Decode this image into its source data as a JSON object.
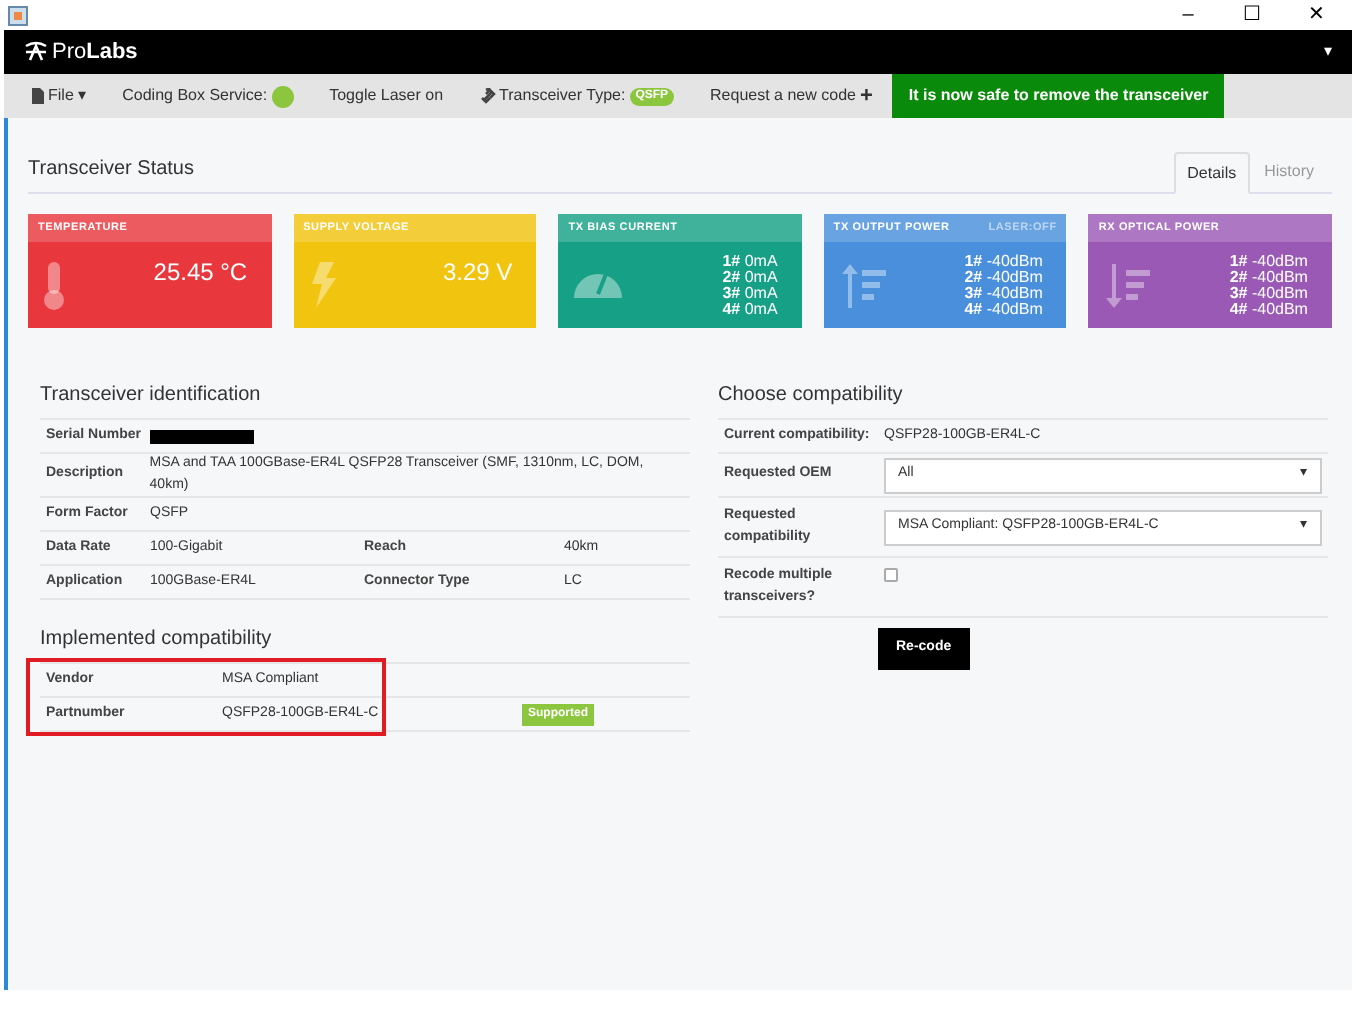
{
  "window": {
    "controls": [
      "–",
      "☐",
      "✕"
    ]
  },
  "app_bar": {
    "logo": "Pro**Labs**",
    "menu_caret": "▾"
  },
  "toolbar": {
    "file": "File",
    "file_caret": "▾",
    "coding_box_label": "Coding Box Service:",
    "coding_box_on": true,
    "toggle_laser": "Toggle Laser on",
    "transceiver_type_label": "Transceiver Type:",
    "transceiver_type": "QSFP",
    "request_code": "Request a new code",
    "request_plus": "+",
    "safe_notice": "It is now safe to remove the transceiver"
  },
  "status": {
    "title": "Transceiver Status",
    "tabs": [
      {
        "label": "Details",
        "selected": true
      },
      {
        "label": "History",
        "selected": false
      }
    ],
    "cards": [
      {
        "kind": "single",
        "title": "TEMPERATURE",
        "color": "#e8383d",
        "value": "25.45 °C"
      },
      {
        "kind": "single",
        "title": "SUPPLY VOLTAGE",
        "color": "#f1c40f",
        "value": "3.29 V"
      },
      {
        "kind": "lanes",
        "title": "TX BIAS CURRENT",
        "color": "#16a085",
        "lanes": [
          {
            "n": "1#",
            "v": "0mA"
          },
          {
            "n": "2#",
            "v": "0mA"
          },
          {
            "n": "3#",
            "v": "0mA"
          },
          {
            "n": "4#",
            "v": "0mA"
          }
        ]
      },
      {
        "kind": "lanes",
        "title": "TX OUTPUT POWER",
        "note": "LASER:OFF",
        "color": "#4a8fdb",
        "lanes": [
          {
            "n": "1#",
            "v": "-40dBm"
          },
          {
            "n": "2#",
            "v": "-40dBm"
          },
          {
            "n": "3#",
            "v": "-40dBm"
          },
          {
            "n": "4#",
            "v": "-40dBm"
          }
        ]
      },
      {
        "kind": "lanes",
        "title": "RX OPTICAL POWER",
        "color": "#9b59b6",
        "lanes": [
          {
            "n": "1#",
            "v": "-40dBm"
          },
          {
            "n": "2#",
            "v": "-40dBm"
          },
          {
            "n": "3#",
            "v": "-40dBm"
          },
          {
            "n": "4#",
            "v": "-40dBm"
          }
        ]
      }
    ]
  },
  "identification": {
    "title": "Transceiver identification",
    "serial_label": "Serial Number",
    "serial_redacted": true,
    "rows": [
      {
        "cells": [
          "Description",
          "MSA and TAA 100GBase-ER4L QSFP28 Transceiver (SMF, 1310nm, LC, DOM, 40km)"
        ]
      },
      {
        "cells": [
          "Form Factor",
          "QSFP"
        ]
      },
      {
        "cells": [
          "Data Rate",
          "100-Gigabit",
          "Reach",
          "40km"
        ]
      },
      {
        "cells": [
          "Application",
          "100GBase-ER4L",
          "Connector Type",
          "LC"
        ]
      }
    ]
  },
  "implemented": {
    "title": "Implemented compatibility",
    "highlighted": true,
    "rows": [
      {
        "label": "Vendor",
        "value": "MSA Compliant"
      },
      {
        "label": "Partnumber",
        "value": "QSFP28-100GB-ER4L-C",
        "badge": "Supported"
      }
    ]
  },
  "choose": {
    "title": "Choose compatibility",
    "current_label": "Current compatibility:",
    "current": "QSFP28-100GB-ER4L-C",
    "oem_label": "Requested OEM",
    "oem": "All",
    "oem_caret": "▾",
    "compat_label": "Requested compatibility",
    "compat": "MSA Compliant: QSFP28-100GB-ER4L-C",
    "compat_caret": "▾",
    "multi_label": "Recode multiple transceivers?",
    "multi_checked": false,
    "button": "Re-code"
  }
}
